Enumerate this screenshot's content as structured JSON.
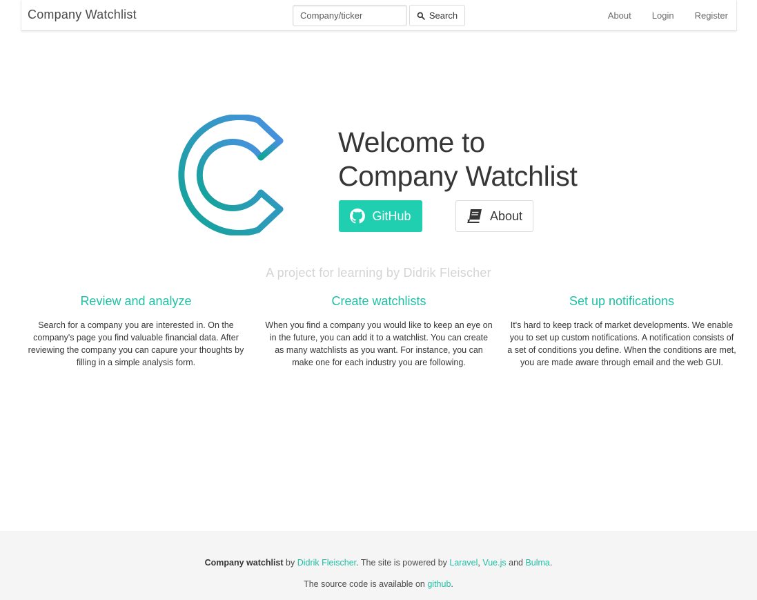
{
  "navbar": {
    "brand": "Company Watchlist",
    "search_placeholder": "Company/ticker",
    "search_button": "Search",
    "links": [
      "About",
      "Login",
      "Register"
    ]
  },
  "hero": {
    "title_line1": "Welcome to",
    "title_line2": "Company Watchlist",
    "github_button": "GitHub",
    "about_button": "About",
    "logo_icon": "company-watchlist-c-logo"
  },
  "tagline": "A project for learning by Didrik Fleischer",
  "features": [
    {
      "title": "Review and analyze",
      "text": "Search for a company you are interested in. On the company's page you find valuable financial data. After reviewing the company you can capure your thoughts by filling in a simple analysis form."
    },
    {
      "title": "Create watchlists",
      "text": "When you find a company you would like to keep an eye on in the future, you can add it to a watchlist. You can create as many watchlists as you want. For instance, you can make one for each industry you are following."
    },
    {
      "title": "Set up notifications",
      "text": "It's hard to keep track of market developments. We enable you to set up custom notifications. A notification consists of a set of conditions you define. When the conditions are met, you are made aware through email and the web GUI."
    }
  ],
  "footer": {
    "site_name": "Company watchlist",
    "by": " by ",
    "author": "Didrik Fleischer",
    "powered": ". The site is powered by ",
    "tech1": "Laravel",
    "comma": ", ",
    "tech2": "Vue.js",
    "and": " and ",
    "tech3": "Bulma",
    "period": ".",
    "source_text": "The source code is available on ",
    "source_link": "github",
    "source_end": "."
  },
  "colors": {
    "accent": "#1fcfb0",
    "link": "#1fbfa4",
    "logo_gradient_start": "#0fa593",
    "logo_gradient_end": "#4a90e2"
  }
}
